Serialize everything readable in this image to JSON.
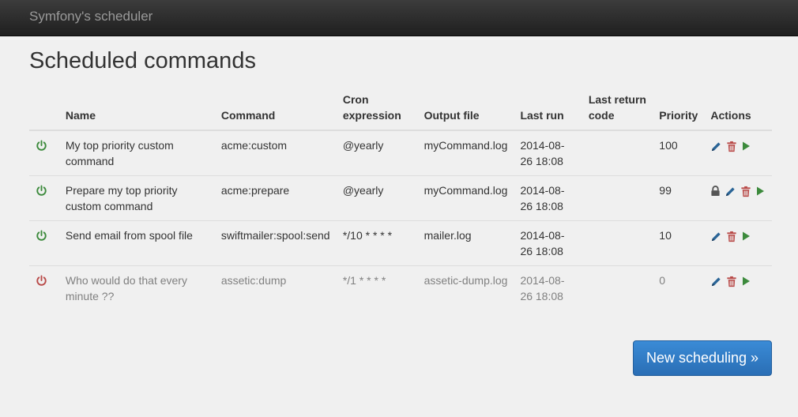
{
  "navbar": {
    "brand": "Symfony's scheduler"
  },
  "page": {
    "title": "Scheduled commands"
  },
  "table": {
    "headers": {
      "name": "Name",
      "command": "Command",
      "cron": "Cron expression",
      "output": "Output file",
      "last_run": "Last run",
      "last_return": "Last return code",
      "priority": "Priority",
      "actions": "Actions"
    },
    "rows": [
      {
        "enabled": true,
        "name": "My top priority custom command",
        "command": "acme:custom",
        "cron": "@yearly",
        "output": "myCommand.log",
        "last_run": "2014-08-26 18:08",
        "last_return": "",
        "priority": "100",
        "locked": false
      },
      {
        "enabled": true,
        "name": "Prepare my top priority custom command",
        "command": "acme:prepare",
        "cron": "@yearly",
        "output": "myCommand.log",
        "last_run": "2014-08-26 18:08",
        "last_return": "",
        "priority": "99",
        "locked": true
      },
      {
        "enabled": true,
        "name": "Send email from spool file",
        "command": "swiftmailer:spool:send",
        "cron": "*/10 * * * *",
        "output": "mailer.log",
        "last_run": "2014-08-26 18:08",
        "last_return": "",
        "priority": "10",
        "locked": false
      },
      {
        "enabled": false,
        "name": "Who would do that every minute ??",
        "command": "assetic:dump",
        "cron": "*/1 * * * *",
        "output": "assetic-dump.log",
        "last_run": "2014-08-26 18:08",
        "last_return": "",
        "priority": "0",
        "locked": false
      }
    ]
  },
  "new_button": {
    "label": "New scheduling »"
  },
  "colors": {
    "enabled": "#3c8a3c",
    "disabled": "#b94a48",
    "edit": "#2a6496",
    "delete": "#b94a48",
    "run": "#3c8a3c",
    "lock": "#555555"
  },
  "icons": [
    "power-icon",
    "lock-icon",
    "pencil-icon",
    "trash-icon",
    "play-icon"
  ]
}
